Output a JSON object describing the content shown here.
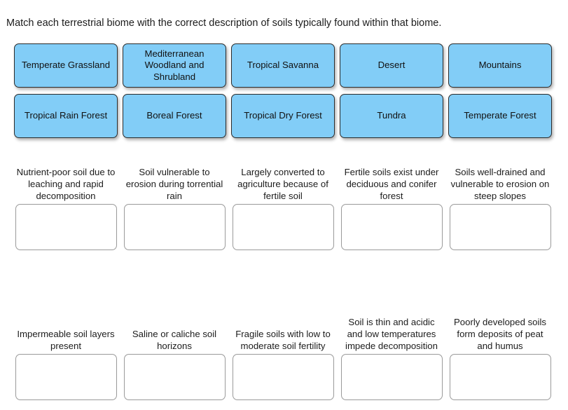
{
  "prompt": "Match each terrestrial biome with the correct description of soils typically found within that biome.",
  "colors": {
    "tile_fill": "#82cdf7",
    "tile_border": "#2b2b2b",
    "dropzone_border": "#9a9a9a",
    "text": "#1c1c1c",
    "background": "#ffffff"
  },
  "tiles": [
    {
      "label": "Temperate Grassland"
    },
    {
      "label": "Mediterranean Woodland and Shrubland"
    },
    {
      "label": "Tropical Savanna"
    },
    {
      "label": "Desert"
    },
    {
      "label": "Mountains"
    },
    {
      "label": "Tropical Rain Forest"
    },
    {
      "label": "Boreal Forest"
    },
    {
      "label": "Tropical Dry Forest"
    },
    {
      "label": "Tundra"
    },
    {
      "label": "Temperate Forest"
    }
  ],
  "answers_row_1": [
    {
      "caption": "Nutrient-poor soil due to leaching and rapid decomposition",
      "value": ""
    },
    {
      "caption": "Soil vulnerable to erosion during torrential rain",
      "value": ""
    },
    {
      "caption": "Largely converted to agriculture because of fertile soil",
      "value": ""
    },
    {
      "caption": "Fertile soils exist under deciduous and conifer forest",
      "value": ""
    },
    {
      "caption": "Soils well-drained and vulnerable to erosion on steep slopes",
      "value": ""
    }
  ],
  "answers_row_2": [
    {
      "caption": "Impermeable soil layers present",
      "value": ""
    },
    {
      "caption": "Saline or caliche soil horizons",
      "value": ""
    },
    {
      "caption": "Fragile soils with low to moderate soil fertility",
      "value": ""
    },
    {
      "caption": "Soil is thin and acidic and low temperatures impede decomposition",
      "value": ""
    },
    {
      "caption": "Poorly developed soils form deposits of peat and humus",
      "value": ""
    }
  ]
}
